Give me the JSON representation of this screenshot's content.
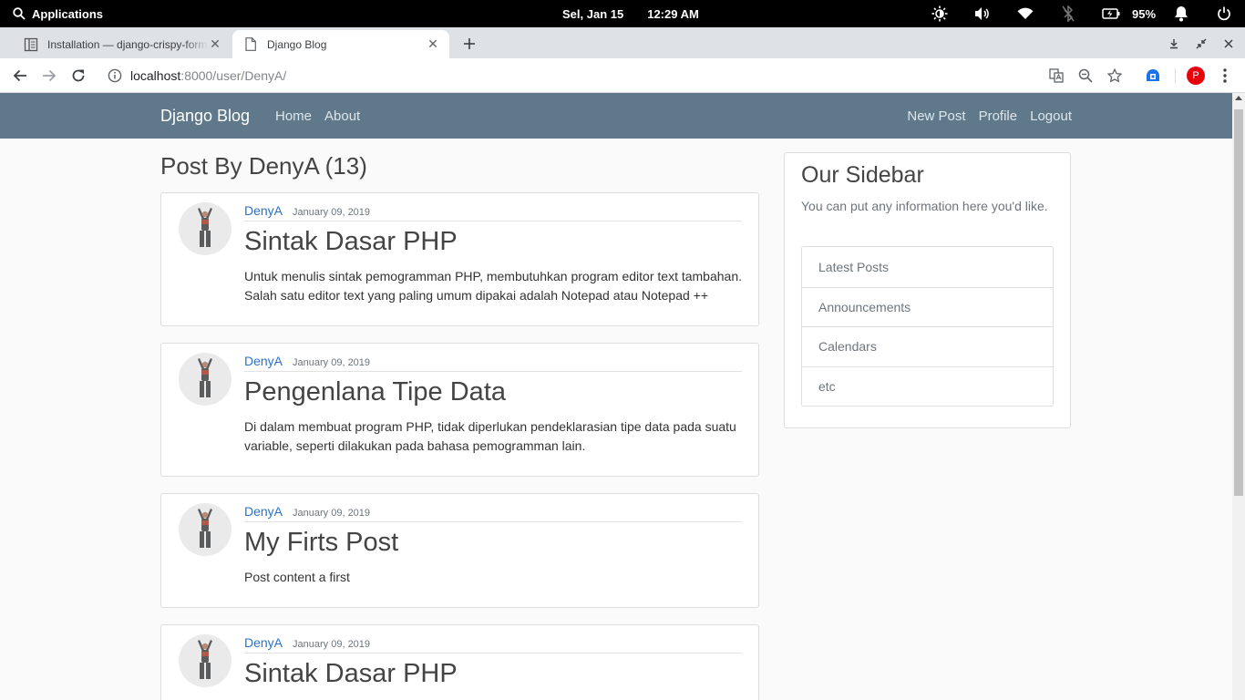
{
  "system_bar": {
    "apps_label": "Applications",
    "date": "Sel, Jan 15",
    "time": "12:29 AM",
    "battery": "95%",
    "icons": [
      "brightness-icon",
      "volume-icon",
      "wifi-icon",
      "bluetooth-off-icon",
      "battery-icon",
      "notification-icon",
      "power-icon"
    ]
  },
  "browser": {
    "tabs": [
      {
        "title": "Installation — django-crispy-forms",
        "favicon": "doc-icon",
        "active": false
      },
      {
        "title": "Django Blog",
        "favicon": "page-icon",
        "active": true
      }
    ],
    "url_host": "localhost",
    "url_rest": ":8000/user/DenyA/",
    "profile_initial": "P"
  },
  "site": {
    "brand": "Django Blog",
    "nav_left": [
      "Home",
      "About"
    ],
    "nav_right": [
      "New Post",
      "Profile",
      "Logout"
    ],
    "heading": "Post By DenyA (13)",
    "posts": [
      {
        "author": "DenyA",
        "date": "January 09, 2019",
        "title": "Sintak Dasar PHP",
        "content": "Untuk menulis sintak pemogramman PHP, membutuhkan program editor text tambahan. Salah satu editor text yang paling umum dipakai adalah Notepad atau Notepad ++"
      },
      {
        "author": "DenyA",
        "date": "January 09, 2019",
        "title": "Pengenlana Tipe Data",
        "content": "Di dalam membuat program PHP, tidak diperlukan pendeklarasian tipe data pada suatu variable, seperti dilakukan pada bahasa pemogramman lain."
      },
      {
        "author": "DenyA",
        "date": "January 09, 2019",
        "title": "My Firts Post",
        "content": "Post content a first"
      },
      {
        "author": "DenyA",
        "date": "January 09, 2019",
        "title": "Sintak Dasar PHP",
        "content": ""
      }
    ],
    "sidebar": {
      "title": "Our Sidebar",
      "text": "You can put any information here you'd like.",
      "items": [
        "Latest Posts",
        "Announcements",
        "Calendars",
        "etc"
      ]
    }
  }
}
